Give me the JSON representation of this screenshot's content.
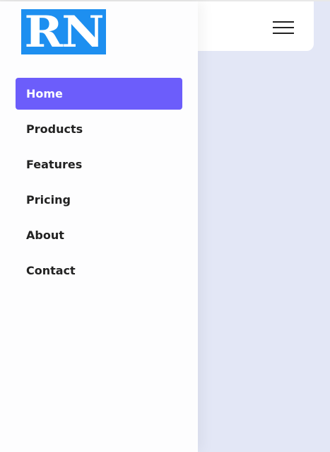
{
  "header": {
    "menu_icon": "hamburger-menu-icon"
  },
  "logo": {
    "text": "RN",
    "color": "#1d8ff0"
  },
  "nav": {
    "items": [
      {
        "label": "Home",
        "active": true
      },
      {
        "label": "Products",
        "active": false
      },
      {
        "label": "Features",
        "active": false
      },
      {
        "label": "Pricing",
        "active": false
      },
      {
        "label": "About",
        "active": false
      },
      {
        "label": "Contact",
        "active": false
      }
    ],
    "active_color": "#6c5dfb"
  },
  "colors": {
    "background": "#e3e7f6",
    "drawer": "#fdfdfe"
  }
}
